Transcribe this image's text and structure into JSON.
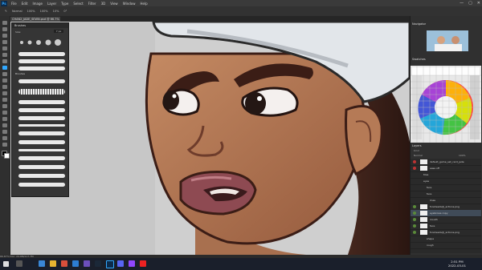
{
  "menubar": {
    "app_badge": "Ps",
    "items": [
      "File",
      "Edit",
      "Image",
      "Layer",
      "Type",
      "Select",
      "Filter",
      "3D",
      "View",
      "Window",
      "Help"
    ],
    "window_controls": [
      "—",
      "▢",
      "✕"
    ]
  },
  "options_bar": {
    "mode": "Normal",
    "opacity": "100%",
    "flow": "100%",
    "smoothing": "10%",
    "angle": "0°"
  },
  "document_tab": "CHAN2_JADE_SEWN.psd @ 66.7% (eyes, RGB/8)",
  "brushes_panel": {
    "title": "Brushes",
    "size_label": "Size:",
    "size_value": "7 px",
    "group_name": "Brushes"
  },
  "navigator": {
    "title": "Navigator"
  },
  "swatches": {
    "title": "Swatches"
  },
  "layers_panel": {
    "title": "Layers",
    "kind": "Kind",
    "blend": "Normal",
    "opacity": "100%",
    "layers": [
      "default_game_set_card_jade",
      "ease off",
      "tiles",
      "eyes",
      "face",
      "face",
      "lines",
      "foreheads@_actions.png",
      "eyebrows copy",
      "mouth",
      "face",
      "foreheads@_actions.png",
      "shape",
      "rough"
    ]
  },
  "status_bar": "66.67%   Doc: 24.9M/117.7M",
  "taskbar": {
    "time": "2:51 PM",
    "date": "2022-03-01"
  },
  "colors": {
    "accent": "#31a8ff",
    "skin": "#b57a56",
    "bandana": "#e2e6ea",
    "lips": "#8e4a52"
  }
}
